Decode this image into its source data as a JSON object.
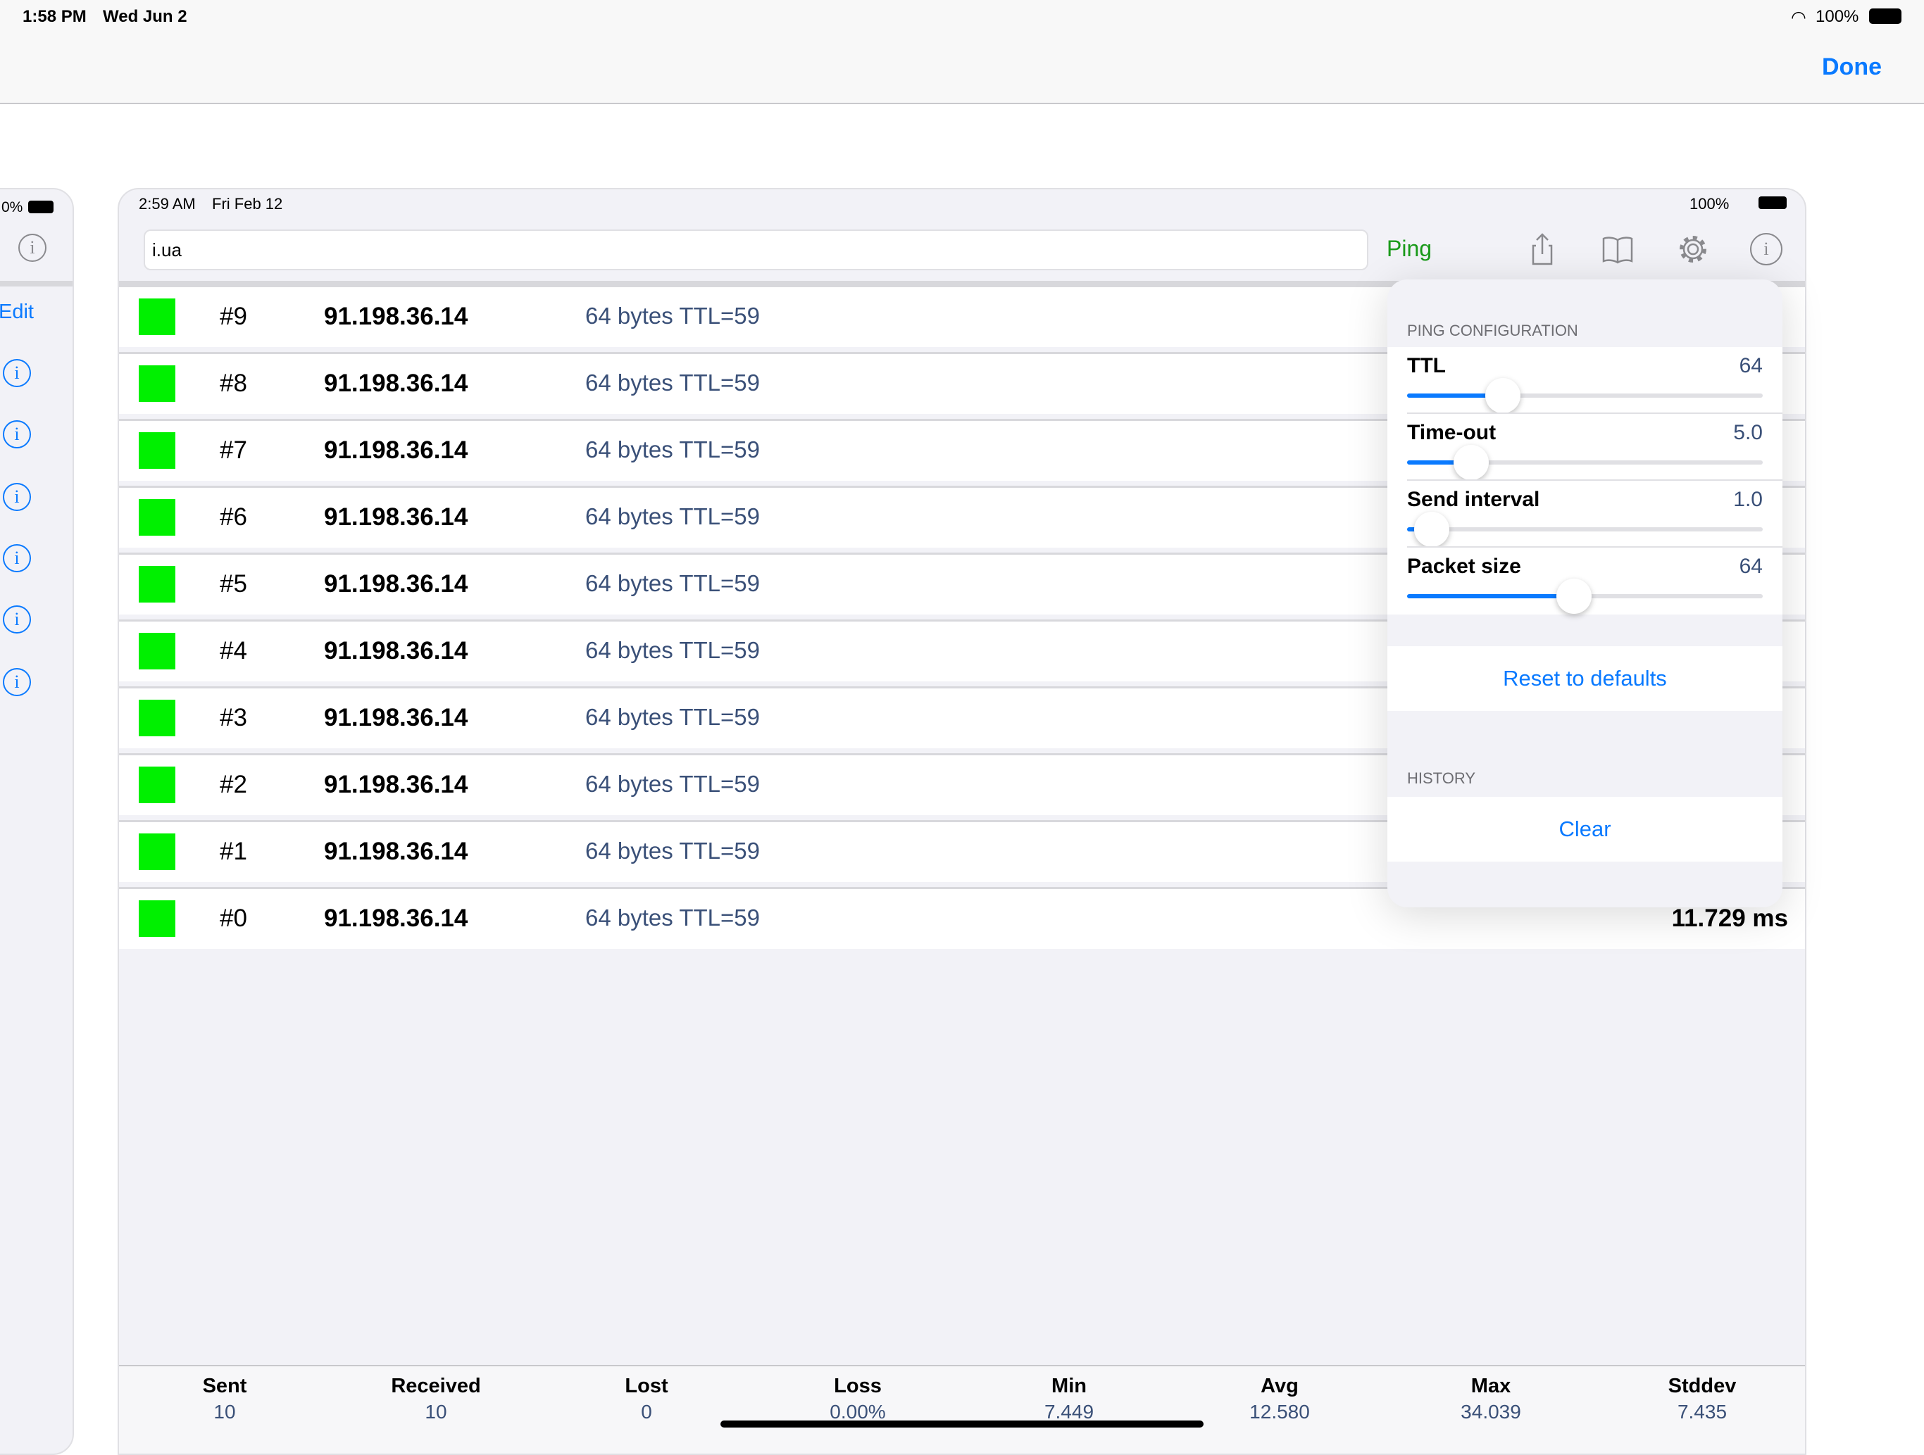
{
  "outer_status": {
    "time": "1:58 PM",
    "date": "Wed Jun 2",
    "battery": "100%"
  },
  "outer_nav": {
    "done_label": "Done"
  },
  "left_card": {
    "battery": "0%",
    "edit_label": "Edit"
  },
  "inner_status": {
    "time": "2:59 AM",
    "date": "Fri Feb 12",
    "battery": "100%"
  },
  "toolbar": {
    "host_value": "i.ua",
    "ping_label": "Ping",
    "icons": [
      "share-icon",
      "bookmarks-icon",
      "gear-icon",
      "info-icon"
    ]
  },
  "results": [
    {
      "seq": "#9",
      "ip": "91.198.36.14",
      "info": "64 bytes TTL=59"
    },
    {
      "seq": "#8",
      "ip": "91.198.36.14",
      "info": "64 bytes TTL=59"
    },
    {
      "seq": "#7",
      "ip": "91.198.36.14",
      "info": "64 bytes TTL=59"
    },
    {
      "seq": "#6",
      "ip": "91.198.36.14",
      "info": "64 bytes TTL=59"
    },
    {
      "seq": "#5",
      "ip": "91.198.36.14",
      "info": "64 bytes TTL=59"
    },
    {
      "seq": "#4",
      "ip": "91.198.36.14",
      "info": "64 bytes TTL=59"
    },
    {
      "seq": "#3",
      "ip": "91.198.36.14",
      "info": "64 bytes TTL=59"
    },
    {
      "seq": "#2",
      "ip": "91.198.36.14",
      "info": "64 bytes TTL=59"
    },
    {
      "seq": "#1",
      "ip": "91.198.36.14",
      "info": "64 bytes TTL=59"
    },
    {
      "seq": "#0",
      "ip": "91.198.36.14",
      "info": "64 bytes TTL=59",
      "time": "11.729 ms"
    }
  ],
  "status_color": "#00f000",
  "popover": {
    "config_header": "PING CONFIGURATION",
    "settings": [
      {
        "label": "TTL",
        "value": "64",
        "level": 0.27
      },
      {
        "label": "Time-out",
        "value": "5.0",
        "level": 0.18
      },
      {
        "label": "Send interval",
        "value": "1.0",
        "level": 0.07
      },
      {
        "label": "Packet size",
        "value": "64",
        "level": 0.47
      }
    ],
    "reset_label": "Reset to defaults",
    "history_header": "HISTORY",
    "clear_label": "Clear"
  },
  "stats": [
    {
      "label": "Sent",
      "value": "10"
    },
    {
      "label": "Received",
      "value": "10"
    },
    {
      "label": "Lost",
      "value": "0"
    },
    {
      "label": "Loss",
      "value": "0.00%"
    },
    {
      "label": "Min",
      "value": "7.449"
    },
    {
      "label": "Avg",
      "value": "12.580"
    },
    {
      "label": "Max",
      "value": "34.039"
    },
    {
      "label": "Stddev",
      "value": "7.435"
    }
  ],
  "accent": "#0a7aff"
}
